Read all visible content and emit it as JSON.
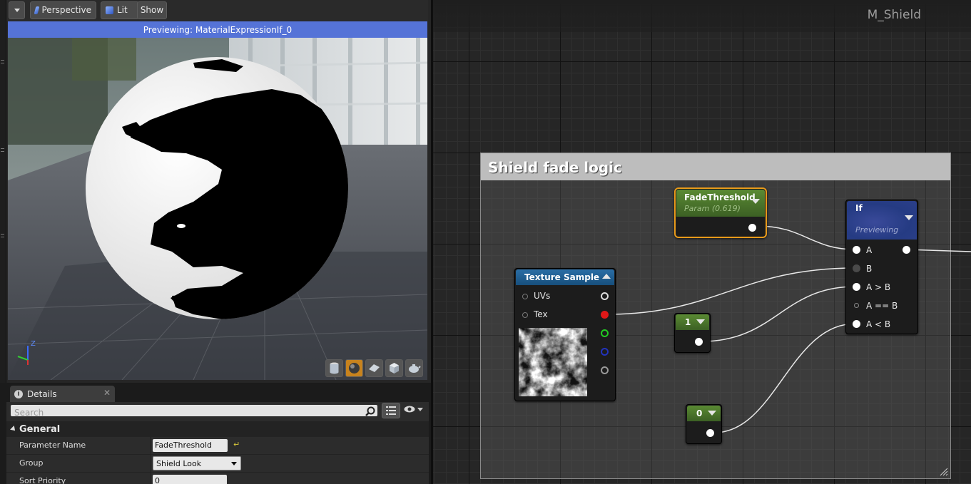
{
  "viewport": {
    "toolbar": {
      "menu_icon": "chevron-down-icon",
      "perspective_label": "Perspective",
      "lit_label": "Lit",
      "show_label": "Show"
    },
    "preview_banner": "Previewing: MaterialExpressionIf_0",
    "axes": {
      "z": "Z"
    },
    "preview_modes": [
      "cylinder",
      "sphere",
      "plane",
      "cube",
      "custom-mesh"
    ],
    "active_mode": "sphere",
    "accent_color": "#5573d7"
  },
  "details": {
    "tab_label": "Details",
    "search_placeholder": "Search",
    "section_label": "General",
    "properties": [
      {
        "label": "Parameter Name",
        "value": "FadeThreshold"
      },
      {
        "label": "Group",
        "value": "Shield Look"
      },
      {
        "label": "Sort Priority",
        "value": "0"
      }
    ]
  },
  "graph": {
    "material_name": "M_Shield",
    "comment_title": "Shield fade logic",
    "nodes": {
      "fade_threshold": {
        "title": "FadeThreshold",
        "subtitle": "Param (0.619)"
      },
      "if_node": {
        "title": "If",
        "subtitle": "Previewing",
        "pins": [
          "A",
          "B",
          "A > B",
          "A == B",
          "A < B"
        ]
      },
      "texture_sample": {
        "title": "Texture Sample",
        "inputs": [
          "UVs",
          "Tex"
        ]
      },
      "const_one": {
        "value": "1"
      },
      "const_zero": {
        "value": "0"
      }
    },
    "colors": {
      "selection_outline": "#e89a1a",
      "param_header": "#4f7a2e",
      "texture_header": "#1d5b8d",
      "if_header": "#2a3f86"
    }
  }
}
